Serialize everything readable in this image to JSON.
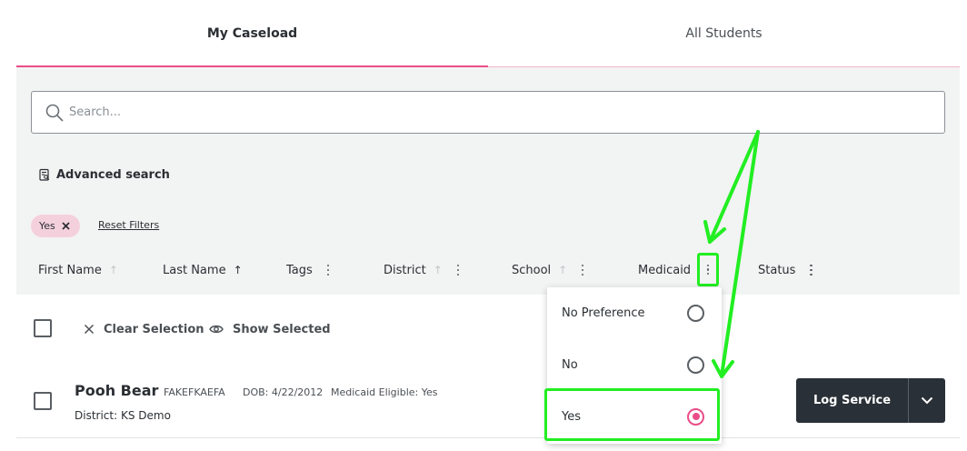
{
  "tabs": [
    {
      "label": "My Caseload",
      "active": true
    },
    {
      "label": "All Students",
      "active": false
    }
  ],
  "search": {
    "placeholder": "Search...",
    "value": ""
  },
  "advanced_search": {
    "label": "Advanced search"
  },
  "filters": {
    "chips": [
      {
        "label": "Yes"
      }
    ],
    "reset_label": "Reset Filters"
  },
  "columns": {
    "first_name": "First Name",
    "last_name": "Last Name",
    "tags": "Tags",
    "district": "District",
    "school": "School",
    "medicaid": "Medicaid",
    "status": "Status"
  },
  "selection": {
    "clear_label": "Clear Selection",
    "show_label": "Show Selected"
  },
  "student": {
    "name": "Pooh Bear",
    "id": "FAKEFKAEFA",
    "dob": "DOB: 4/22/2012",
    "medicaid": "Medicaid Eligible: Yes",
    "district_label": "District:",
    "district_value": "KS Demo"
  },
  "log_service": {
    "label": "Log Service"
  },
  "medicaid_menu": {
    "options": [
      {
        "label": "No Preference",
        "selected": false
      },
      {
        "label": "No",
        "selected": false
      },
      {
        "label": "Yes",
        "selected": true
      }
    ]
  },
  "colors": {
    "accent_pink": "#ea4c89",
    "annotation_green": "#22ee22",
    "dark_button": "#2a3037",
    "panel_gray": "#f2f3f3"
  },
  "icons": [
    "search-icon",
    "clipboard-search-icon",
    "close-icon",
    "sort-up-arrow-icon",
    "kebab-menu-icon",
    "close-x-icon",
    "eye-icon",
    "chevron-down-icon",
    "radio-icon",
    "annotation-arrow"
  ]
}
